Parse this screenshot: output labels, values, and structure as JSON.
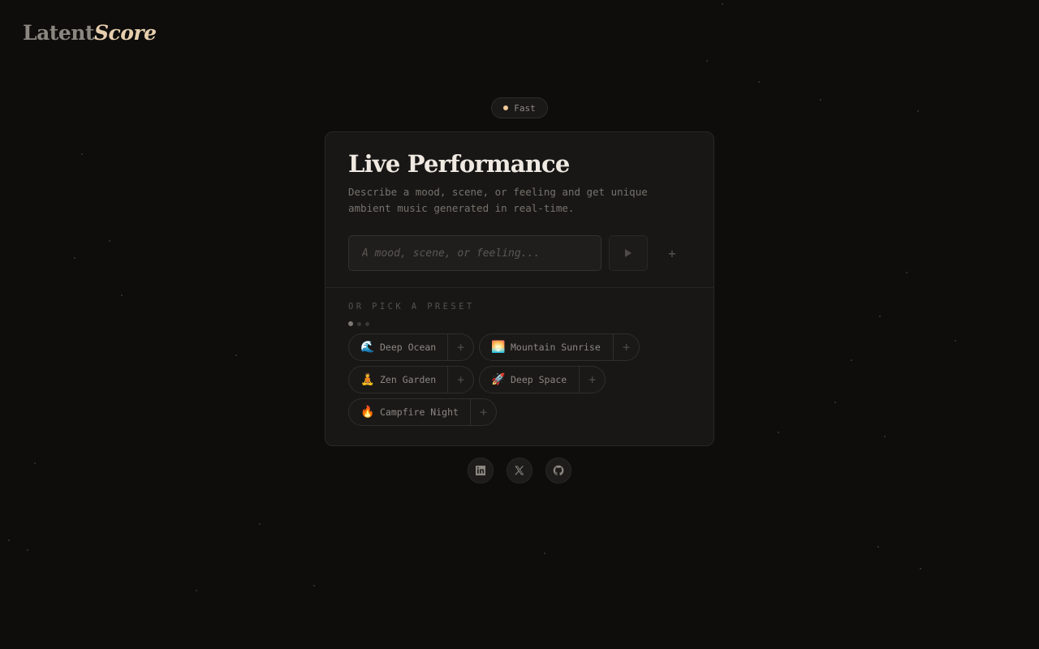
{
  "brand": {
    "part1": "Latent",
    "part2": "Score"
  },
  "mode": {
    "label": "Fast",
    "accent": "#f2c99a"
  },
  "card": {
    "title": "Live Performance",
    "subtitle": "Describe a mood, scene, or feeling and get unique ambient music generated in real-time.",
    "prompt_placeholder": "A mood, scene, or feeling...",
    "prompt_value": "",
    "play_icon": "play-icon",
    "add_icon": "plus-icon",
    "add_glyph": "+",
    "preset_heading": "OR PICK A PRESET",
    "preset_pages": {
      "count": 3,
      "current": 1
    },
    "presets": [
      {
        "emoji": "🌊",
        "label": "Deep Ocean",
        "add": "+"
      },
      {
        "emoji": "🌅",
        "label": "Mountain Sunrise",
        "add": "+"
      },
      {
        "emoji": "🧘",
        "label": "Zen Garden",
        "add": "+"
      },
      {
        "emoji": "🚀",
        "label": "Deep Space",
        "add": "+"
      },
      {
        "emoji": "🔥",
        "label": "Campfire Night",
        "add": "+"
      }
    ]
  },
  "socials": [
    {
      "icon": "linkedin-icon"
    },
    {
      "icon": "x-icon"
    },
    {
      "icon": "github-icon"
    }
  ],
  "colors": {
    "background": "#0e0d0c",
    "card": "#181716",
    "title": "#efe9e1",
    "brand_accent": "#e7cfae"
  }
}
